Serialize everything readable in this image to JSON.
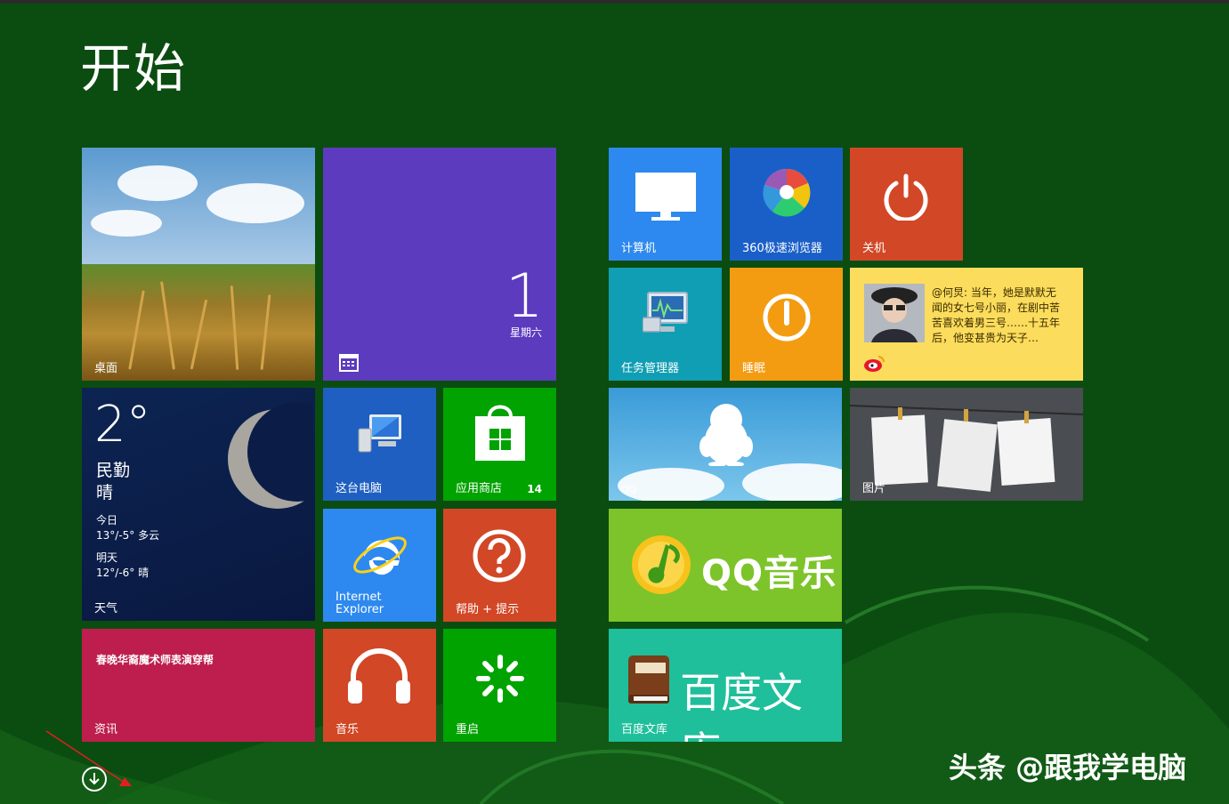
{
  "start": {
    "title": "开始"
  },
  "tiles": {
    "desktop": {
      "label": "桌面"
    },
    "calendar": {
      "date": "1",
      "weekday": "星期六"
    },
    "computer": {
      "label": "计算机"
    },
    "browser360": {
      "label": "360极速浏览器"
    },
    "shutdown": {
      "label": "关机"
    },
    "taskmanager": {
      "label": "任务管理器"
    },
    "sleep": {
      "label": "睡眠"
    },
    "weibo": {
      "text": "@何炅: 当年，她是默默无闻的女七号小丽，在剧中苦苦喜欢着男三号……十五年后，他变甚贵为天子…"
    },
    "weather": {
      "temp": "2°",
      "city": "民勤",
      "condition": "晴",
      "today_label": "今日",
      "today_range": "13°/-5° 多云",
      "tomorrow_label": "明天",
      "tomorrow_range": "12°/-6° 晴",
      "label": "天气"
    },
    "thispc": {
      "label": "这台电脑"
    },
    "store": {
      "label": "应用商店",
      "count": "14"
    },
    "qq": {
      "label": "QQ"
    },
    "photos": {
      "label": "图片"
    },
    "ie": {
      "label_line1": "Internet",
      "label_line2": "Explorer"
    },
    "help": {
      "label": "帮助 + 提示"
    },
    "qqmusic": {
      "text": "QQ音乐"
    },
    "news": {
      "headline": "春晚华裔魔术师表演穿帮",
      "label": "资讯"
    },
    "music": {
      "label": "音乐"
    },
    "restart": {
      "label": "重启"
    },
    "baidu": {
      "text": "百度文库",
      "label": "百度文库"
    }
  },
  "watermark": {
    "text": "头条 @跟我学电脑"
  },
  "colors": {
    "background": "#0b4d10",
    "purple": "#5c3bbf",
    "blue": "#2d89ef",
    "red": "#d24726",
    "teal": "#0f9eb4",
    "orange": "#f39c12",
    "green": "#00a300",
    "lime": "#7dc42a",
    "crimson": "#be1e4d",
    "mint": "#1fbf9b"
  }
}
